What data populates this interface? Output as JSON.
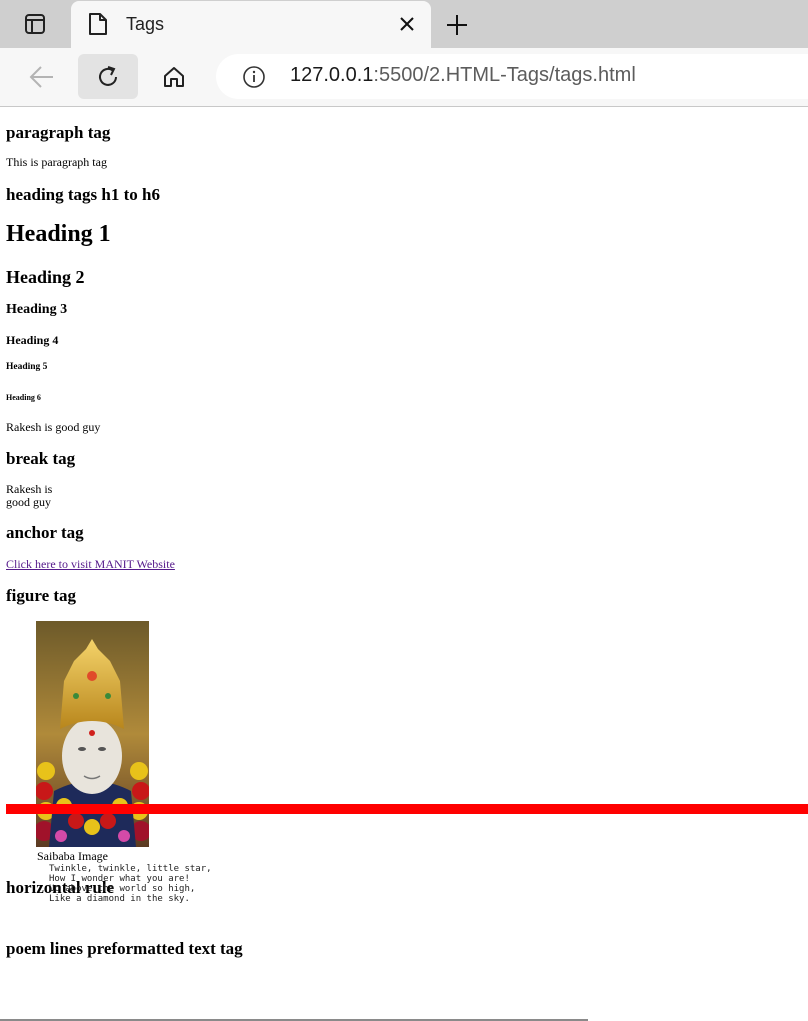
{
  "browser": {
    "tab_title": "Tags",
    "url_host": "127.0.0.1",
    "url_rest": ":5500/2.HTML-Tags/tags.html",
    "icons": [
      "tab-actions-icon",
      "page-icon",
      "close-icon",
      "plus-icon",
      "back-arrow-icon",
      "reload-icon",
      "home-icon",
      "info-icon"
    ]
  },
  "page": {
    "paragraph_heading": "paragraph tag",
    "paragraph_text": "This is paragraph tag",
    "heading_tags_heading": "heading tags h1 to h6",
    "h1": "Heading 1",
    "h2": "Heading 2",
    "h3": "Heading 3",
    "h4": "Heading 4",
    "h5": "Heading 5",
    "h6": "Heading 6",
    "rakesh_line": "Rakesh is good guy",
    "break_heading": "break tag",
    "break_line1": "Rakesh is",
    "break_line2": "good guy",
    "anchor_heading": "anchor tag",
    "anchor_link": "Click here to visit MANIT Website",
    "figure_heading": "figure tag",
    "figure_caption": "Saibaba Image",
    "hr_heading": "horizontal rule",
    "hr_color": "#ff0000",
    "pre_heading": "poem lines preformatted text tag",
    "poem_lines": [
      "Twinkle, twinkle, little star,",
      "How I wonder what you are!",
      "Up above the world so high,",
      "Like a diamond in the sky."
    ]
  }
}
